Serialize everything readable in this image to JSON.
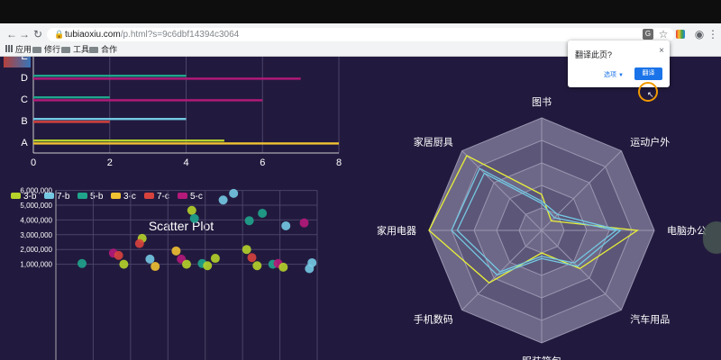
{
  "browser": {
    "url_host": "tubiaoxiu.com",
    "url_path": "/p.html?s=9c6dbf14394c3064",
    "bookmarks": [
      "应用",
      "修行",
      "工具",
      "合作"
    ]
  },
  "translate_popup": {
    "title": "翻译此页?",
    "close": "×",
    "options_label": "选项",
    "translate_button": "翻译"
  },
  "chart_data": [
    {
      "type": "bar",
      "orientation": "horizontal",
      "categories": [
        "A",
        "B",
        "C",
        "D",
        "E"
      ],
      "x_ticks": [
        "0",
        "2",
        "4",
        "6",
        "8"
      ],
      "xlim": [
        0,
        8
      ],
      "series": [
        {
          "name": "3-b",
          "color": "#b5d32a",
          "values": [
            5,
            0,
            0,
            0,
            0
          ]
        },
        {
          "name": "7-b",
          "color": "#74c9e3",
          "values": [
            0,
            4,
            0,
            0,
            0
          ]
        },
        {
          "name": "5-b",
          "color": "#1fa58c",
          "values": [
            0,
            0,
            2,
            4,
            0
          ]
        },
        {
          "name": "3-c",
          "color": "#f1c232",
          "values": [
            8,
            0,
            0,
            0,
            2
          ]
        },
        {
          "name": "7-c",
          "color": "#d8423d",
          "values": [
            0,
            2,
            0,
            0,
            0
          ]
        },
        {
          "name": "5-c",
          "color": "#b5197a",
          "values": [
            0,
            0,
            6,
            7,
            0
          ]
        }
      ],
      "legend": "bottom-left",
      "grid": true
    },
    {
      "type": "scatter",
      "title": "Scatter Plot",
      "y_ticks": [
        "6,000,000",
        "5,000,000",
        "4,000,000",
        "3,000,000",
        "2,000,000",
        "1,000,000"
      ],
      "ylim": [
        0,
        6000000
      ],
      "xlim": [
        0,
        100
      ],
      "grid": true,
      "points": [
        {
          "x": 10,
          "y": 1050000,
          "color": "#1fa58c"
        },
        {
          "x": 22,
          "y": 1750000,
          "color": "#b5197a"
        },
        {
          "x": 24,
          "y": 1600000,
          "color": "#d8423d"
        },
        {
          "x": 26,
          "y": 1000000,
          "color": "#b5d32a"
        },
        {
          "x": 33,
          "y": 2750000,
          "color": "#b5d32a"
        },
        {
          "x": 32,
          "y": 2400000,
          "color": "#d8423d"
        },
        {
          "x": 36,
          "y": 1350000,
          "color": "#74c9e3"
        },
        {
          "x": 38,
          "y": 850000,
          "color": "#f1c232"
        },
        {
          "x": 46,
          "y": 1900000,
          "color": "#f1c232"
        },
        {
          "x": 48,
          "y": 1350000,
          "color": "#b5197a"
        },
        {
          "x": 50,
          "y": 1000000,
          "color": "#b5d32a"
        },
        {
          "x": 52,
          "y": 4650000,
          "color": "#b5d32a"
        },
        {
          "x": 53,
          "y": 4100000,
          "color": "#1fa58c"
        },
        {
          "x": 56,
          "y": 1050000,
          "color": "#1fa58c"
        },
        {
          "x": 58,
          "y": 900000,
          "color": "#b5d32a"
        },
        {
          "x": 61,
          "y": 1400000,
          "color": "#b5d32a"
        },
        {
          "x": 64,
          "y": 5350000,
          "color": "#74c9e3"
        },
        {
          "x": 68,
          "y": 5800000,
          "color": "#74c9e3"
        },
        {
          "x": 74,
          "y": 3950000,
          "color": "#1fa58c"
        },
        {
          "x": 73,
          "y": 2000000,
          "color": "#b5d32a"
        },
        {
          "x": 75,
          "y": 1450000,
          "color": "#d8423d"
        },
        {
          "x": 77,
          "y": 900000,
          "color": "#b5d32a"
        },
        {
          "x": 79,
          "y": 4450000,
          "color": "#1fa58c"
        },
        {
          "x": 83,
          "y": 1000000,
          "color": "#1fa58c"
        },
        {
          "x": 88,
          "y": 3600000,
          "color": "#74c9e3"
        },
        {
          "x": 95,
          "y": 3800000,
          "color": "#b5197a"
        },
        {
          "x": 98,
          "y": 1100000,
          "color": "#74c9e3"
        },
        {
          "x": 85,
          "y": 1050000,
          "color": "#b5197a"
        },
        {
          "x": 87,
          "y": 800000,
          "color": "#b5d32a"
        },
        {
          "x": 97,
          "y": 700000,
          "color": "#74c9e3"
        }
      ]
    },
    {
      "type": "radar",
      "axes": [
        "图书",
        "运动户外",
        "电脑办公",
        "汽车用品",
        "服装箱包",
        "手机数码",
        "家用电器",
        "家居厨具"
      ],
      "max": 100,
      "levels": 5,
      "series": [
        {
          "color": "#e8f038",
          "values": [
            32,
            12,
            85,
            48,
            20,
            66,
            100,
            94
          ]
        },
        {
          "color": "#74c9e3",
          "values": [
            26,
            20,
            70,
            45,
            25,
            56,
            80,
            78
          ]
        },
        {
          "color": "#74c9e3",
          "values": [
            24,
            16,
            66,
            41,
            23,
            52,
            75,
            72
          ]
        }
      ]
    }
  ]
}
